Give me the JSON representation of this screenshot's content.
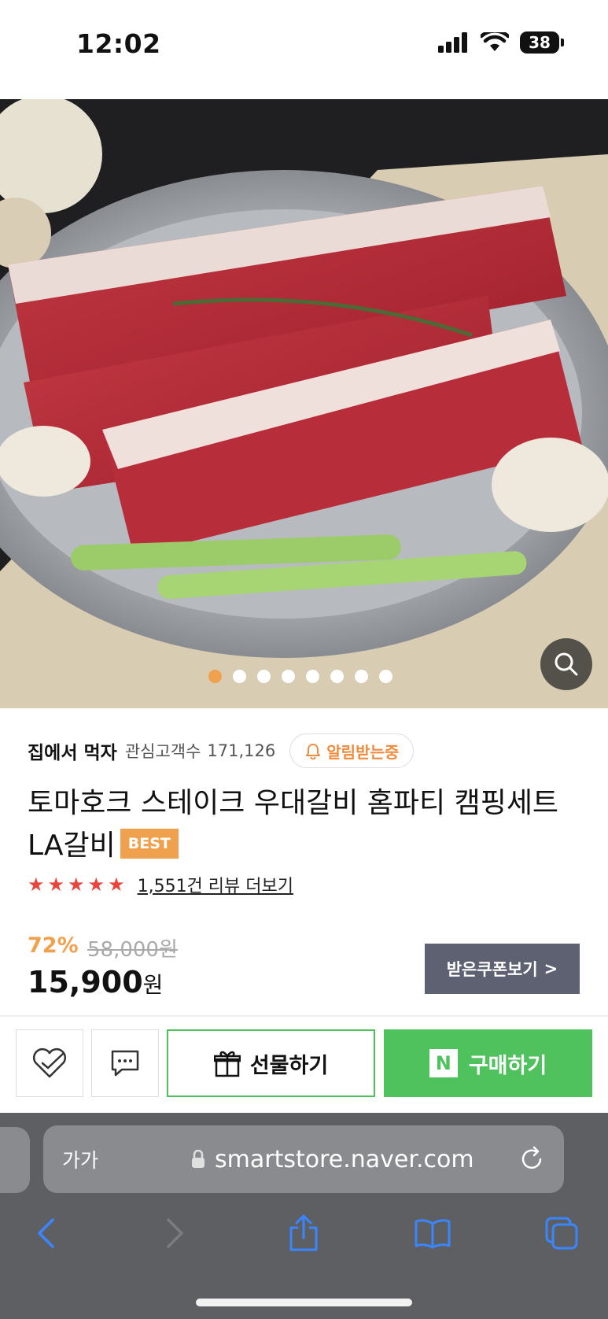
{
  "status_bar": {
    "time": "12:02",
    "battery": "38"
  },
  "gallery": {
    "slide_count": 8,
    "active_index": 0,
    "accent": "#f0a14e"
  },
  "store": {
    "name": "집에서 먹자",
    "fans_label": "관심고객수",
    "fans_count": "171,126",
    "notify_label": "알림받는중"
  },
  "product": {
    "title": "토마호크 스테이크 우대갈비 홈파티 캠핑세트 LA갈비",
    "badge": "BEST",
    "rating_stars": 5,
    "review_link": "1,551건 리뷰 더보기",
    "discount": "72%",
    "original_price": "58,000원",
    "sale_price": "15,900",
    "currency": "원",
    "coupon_label": "받은쿠폰보기",
    "coupon_chevron": ">"
  },
  "actions": {
    "gift_label": "선물하기",
    "buy_label": "구매하기",
    "buy_logo": "N",
    "buy_color": "#4fc15d"
  },
  "browser": {
    "text_size_label": "가가",
    "url": "smartstore.naver.com"
  }
}
